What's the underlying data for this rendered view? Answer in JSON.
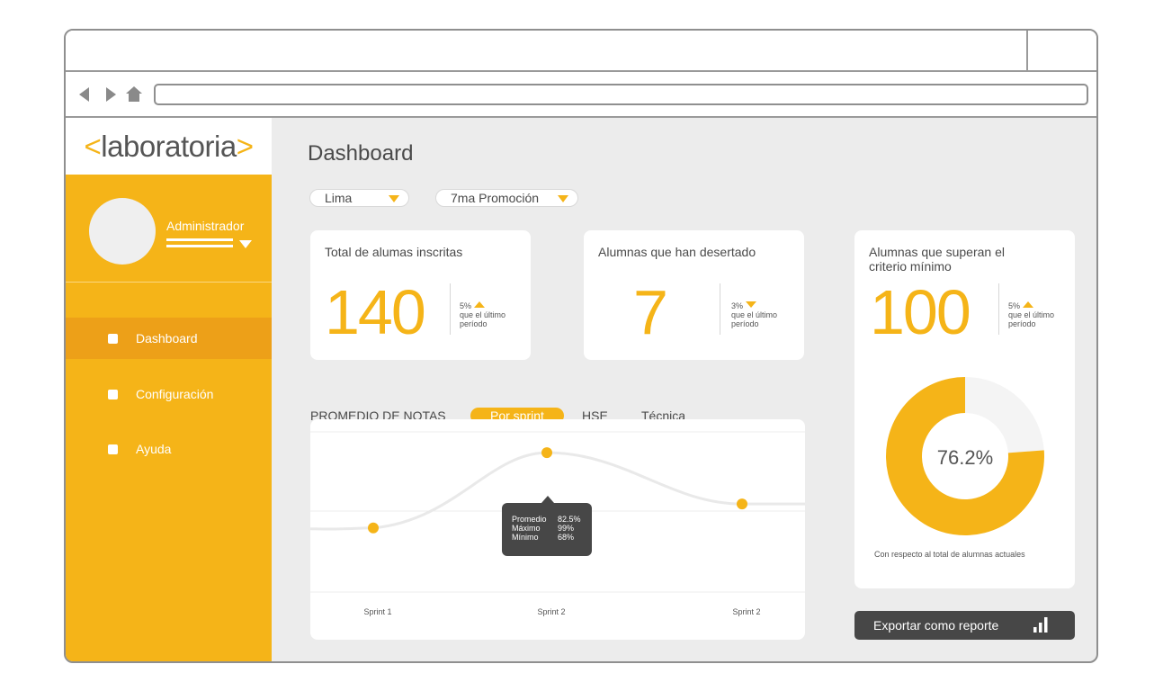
{
  "brand": {
    "logo_open": "<",
    "logo_text": "laboratoria",
    "logo_close": ">"
  },
  "user": {
    "name": "Administrador"
  },
  "sidebar": {
    "items": [
      {
        "label": "Dashboard",
        "active": true
      },
      {
        "label": "Configuración",
        "active": false
      },
      {
        "label": "Ayuda",
        "active": false
      }
    ]
  },
  "page": {
    "title": "Dashboard"
  },
  "filters": {
    "city": "Lima",
    "promotion": "7ma Promoción"
  },
  "stats": {
    "enrolled": {
      "title": "Total de alumas inscritas",
      "value": "140",
      "delta": "5%",
      "delta_dir": "up",
      "delta_text": "que el último período"
    },
    "dropped": {
      "title": "Alumnas que han desertado",
      "value": "7",
      "delta": "3%",
      "delta_dir": "down",
      "delta_text": "que el último período"
    },
    "passing": {
      "title": "Alumnas que superan el criterio mínimo",
      "value": "100",
      "delta": "5%",
      "delta_dir": "up",
      "delta_text": "que el último período"
    }
  },
  "grades": {
    "label": "PROMEDIO DE NOTAS",
    "tabs": [
      "Por sprint",
      "HSE",
      "Técnica"
    ],
    "active_tab": "Por sprint"
  },
  "chart_data": [
    {
      "type": "line",
      "categories": [
        "Sprint 1",
        "Sprint 2",
        "Sprint 2"
      ],
      "series": [
        {
          "values": [
            0.4,
            0.87,
            0.55
          ]
        }
      ],
      "tooltip": {
        "point": "Sprint 2",
        "rows": [
          {
            "label": "Promedio",
            "value": "82.5%"
          },
          {
            "label": "Máximo",
            "value": "99%"
          },
          {
            "label": "Mínimo",
            "value": "68%"
          }
        ]
      },
      "colors": {
        "point": "#f5b418",
        "line": "#e9e9e9"
      }
    },
    {
      "type": "pie",
      "center_label": "76.2%",
      "values": [
        76.2,
        23.8
      ],
      "caption": "Con respecto al total de alumnas actuales",
      "colors": [
        "#f5b418",
        "#f4f4f4"
      ]
    }
  ],
  "export": {
    "label": "Exportar como reporte",
    "icon": "bar-chart-icon"
  },
  "colors": {
    "accent": "#f5b418",
    "accent_dark": "#eda018",
    "dark": "#474747"
  }
}
